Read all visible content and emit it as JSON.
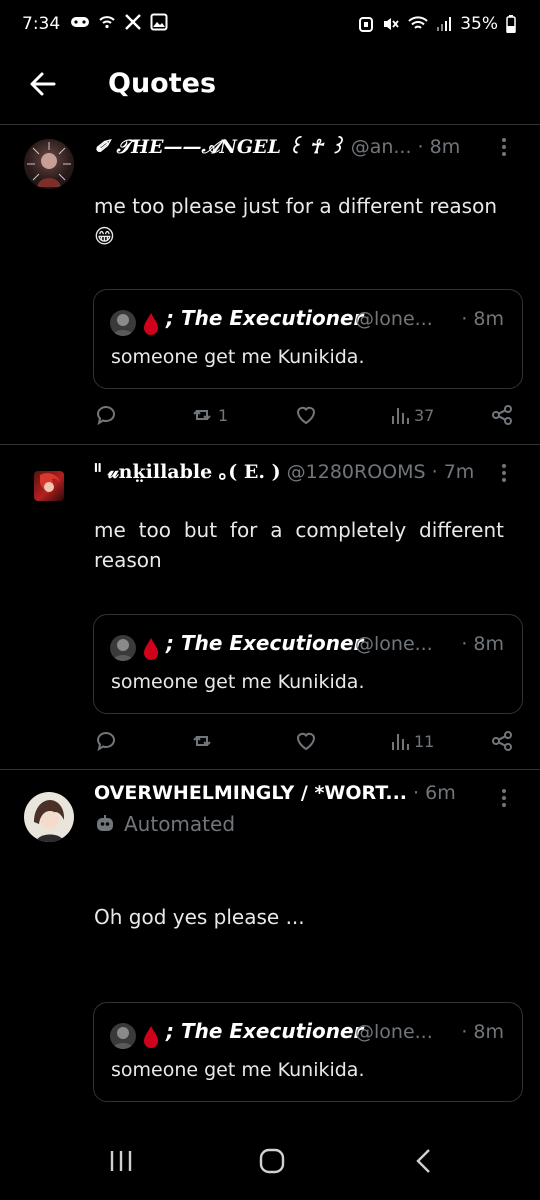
{
  "status": {
    "time": "7:34",
    "battery": "35%"
  },
  "header": {
    "title": "Quotes"
  },
  "posts": [
    {
      "name": "✐ 𝒯HE——𝒜NGEL ꒰ ☥ ꒱",
      "handle": "@an...",
      "time": "· 8m",
      "text": "me too please just for a different reason 😁",
      "quote": {
        "name": "; The Executioner",
        "handle": "@lone...",
        "time": "· 8m",
        "text": "someone get me Kunikida."
      },
      "actions": {
        "replies": "",
        "reposts": "1",
        "likes": "",
        "views": "37"
      }
    },
    {
      "name": "ᐦ 𝓊nk̤illable ｡( E. )",
      "handle": "@1280ROOMS",
      "time": "· 7m",
      "text": "me too but for a completely different reason",
      "quote": {
        "name": "; The Executioner",
        "handle": "@lone...",
        "time": "· 8m",
        "text": "someone get me Kunikida."
      },
      "actions": {
        "replies": "",
        "reposts": "",
        "likes": "",
        "views": "11"
      }
    },
    {
      "name": "OVERWHELMINGLY / *WORT...",
      "handle": "",
      "time": "· 6m",
      "automated": "Automated",
      "text": "Oh god yes please ...",
      "quote": {
        "name": "; The Executioner",
        "handle": "@lone...",
        "time": "· 8m",
        "text": "someone get me Kunikida."
      }
    }
  ],
  "colors": {
    "background": "#000000",
    "divider": "#2f3336",
    "muted": "#71767b",
    "text": "#e7e9ea",
    "drop": "#d0021b"
  }
}
